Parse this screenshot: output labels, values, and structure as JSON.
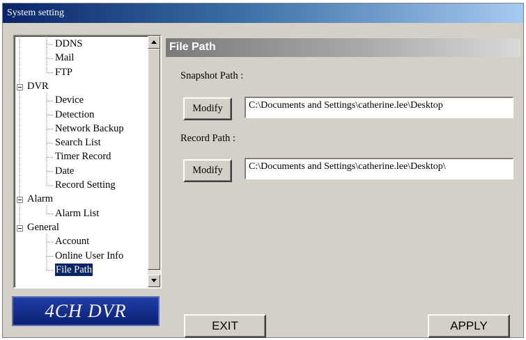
{
  "window": {
    "title": "System setting"
  },
  "tree": {
    "nodes": [
      {
        "label": "DDNS",
        "expandable": false
      },
      {
        "label": "Mail",
        "expandable": false
      },
      {
        "label": "FTP",
        "expandable": false
      },
      {
        "label": "DVR",
        "expandable": true
      },
      {
        "label": "Device",
        "expandable": false
      },
      {
        "label": "Detection",
        "expandable": false
      },
      {
        "label": "Network Backup",
        "expandable": false
      },
      {
        "label": "Search List",
        "expandable": false
      },
      {
        "label": "Timer Record",
        "expandable": false
      },
      {
        "label": "Date",
        "expandable": false
      },
      {
        "label": "Record Setting",
        "expandable": false
      },
      {
        "label": "Alarm",
        "expandable": true
      },
      {
        "label": "Alarm List",
        "expandable": false
      },
      {
        "label": "General",
        "expandable": true
      },
      {
        "label": "Account",
        "expandable": false
      },
      {
        "label": "Online User Info",
        "expandable": false
      },
      {
        "label": "File Path",
        "expandable": false,
        "selected": true
      }
    ]
  },
  "logo": {
    "text": "4CH DVR"
  },
  "panel": {
    "header": "File Path",
    "snapshot_label": "Snapshot Path :",
    "snapshot_modify": "Modify",
    "snapshot_value": "C:\\Documents and Settings\\catherine.lee\\Desktop",
    "record_label": "Record Path :",
    "record_modify": "Modify",
    "record_value": "C:\\Documents and Settings\\catherine.lee\\Desktop\\"
  },
  "buttons": {
    "exit": "EXIT",
    "apply": "APPLY"
  },
  "colors": {
    "titlebar_start": "#0a246a",
    "selection": "#0a246a",
    "logo_bg": "#1e3ea8",
    "face": "#d4d0c8"
  }
}
